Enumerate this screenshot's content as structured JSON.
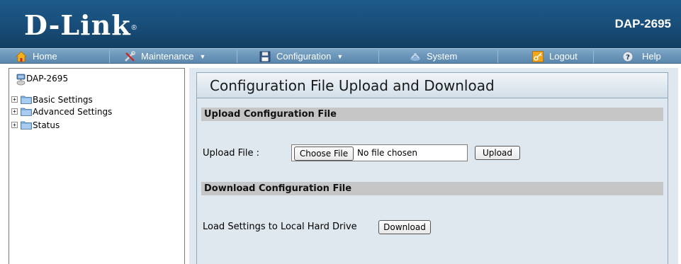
{
  "header": {
    "logo_text": "D-Link",
    "logo_reg": "®",
    "model": "DAP-2695"
  },
  "nav": {
    "home": "Home",
    "maintenance": "Maintenance",
    "configuration": "Configuration",
    "system": "System",
    "logout": "Logout",
    "help": "Help",
    "icons": [
      "home-icon",
      "tools-icon",
      "floppy-disk-icon",
      "system-icon",
      "key-icon",
      "help-icon"
    ]
  },
  "tree": {
    "root": "DAP-2695",
    "items": [
      "Basic Settings",
      "Advanced Settings",
      "Status"
    ]
  },
  "main": {
    "title": "Configuration File Upload and Download",
    "upload_section": "Upload Configuration File",
    "upload_label": "Upload File :",
    "choose_file": "Choose File",
    "no_file": "No file chosen",
    "upload_button": "Upload",
    "download_section": "Download Configuration File",
    "download_label": "Load Settings to Local Hard Drive",
    "download_button": "Download"
  },
  "colors": {
    "header_blue": "#1e5a8a",
    "nav_blue": "#6b96b9",
    "content_bg": "#dfe8ef",
    "section_gray": "#c6c6c6"
  }
}
